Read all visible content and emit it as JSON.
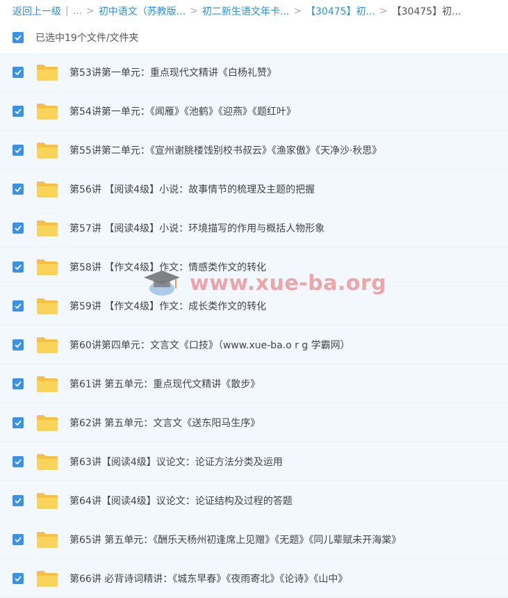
{
  "breadcrumb": {
    "back": "返回上一级",
    "sep_pipe": "|",
    "ellipsis": "...",
    "items": [
      "初中语文（苏教版...",
      "初二新生语文年卡...",
      "【30475】初...",
      "【30475】初..."
    ]
  },
  "selection": {
    "label": "已选中19个文件/文件夹"
  },
  "files": [
    "第53讲第一单元：重点现代文精讲《白杨礼赞》",
    "第54讲第一单元：《闻雁》《池鹤》《迎燕》《题红叶》",
    "第55讲第二单元：《宣州谢朓楼饯别校书叔云》《渔家傲》《天净沙·秋思》",
    "第56讲 【阅读4级】小说：故事情节的梳理及主题的把握",
    "第57讲 【阅读4级】小说：环境描写的作用与概括人物形象",
    "第58讲 【作文4级】作文：情感类作文的转化",
    "第59讲 【作文4级】作文：成长类作文的转化",
    "第60讲第四单元：文言文《口技》（www.xue-ba.o r g 学霸网）",
    "第61讲 第五单元：重点现代文精讲《散步》",
    "第62讲 第五单元：文言文《送东阳马生序》",
    "第63讲【阅读4级】议论文：论证方法分类及运用",
    "第64讲【阅读4级】议论文：论证结构及过程的答题",
    "第65讲 第五单元：《酬乐天杨州初逢席上见赠》《无题》《同儿辈赋未开海棠》",
    "第66讲 必背诗词精讲：《城东早春》《夜雨寄北》《论诗》《山中》"
  ],
  "watermark": {
    "text": "www.xue-ba.org"
  },
  "colors": {
    "accent": "#3b93e8",
    "folder": "#f8c948",
    "row_bg": "#f2f8fe",
    "link": "#2a8fe0"
  }
}
